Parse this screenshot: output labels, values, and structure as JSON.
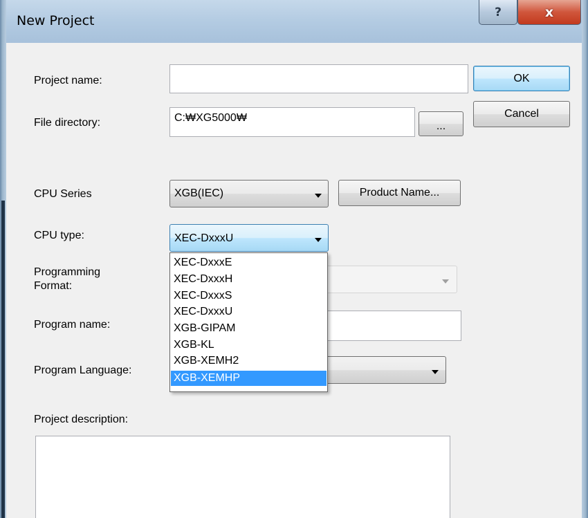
{
  "window": {
    "title": "New Project",
    "help_label": "?",
    "close_label": "x"
  },
  "form": {
    "project_name_label": "Project name:",
    "project_name_value": "",
    "file_directory_label": "File directory:",
    "file_directory_value": "C:₩XG5000₩",
    "browse_label": "...",
    "cpu_series_label": "CPU Series",
    "cpu_series_value": "XGB(IEC)",
    "product_name_label": "Product Name...",
    "cpu_type_label": "CPU type:",
    "cpu_type_value": "XEC-DxxxU",
    "programming_format_label_line1": "Programming",
    "programming_format_label_line2": "Format:",
    "programming_format_value": "",
    "program_name_label": "Program name:",
    "program_name_value": "",
    "program_language_label": "Program Language:",
    "program_language_value": "",
    "project_description_label": "Project description:",
    "project_description_value": ""
  },
  "buttons": {
    "ok_label": "OK",
    "cancel_label": "Cancel"
  },
  "cpu_type_dropdown": {
    "options": [
      "XEC-DxxxE",
      "XEC-DxxxH",
      "XEC-DxxxS",
      "XEC-DxxxU",
      "XGB-GIPAM",
      "XGB-KL",
      "XGB-XEMH2",
      "XGB-XEMHP"
    ],
    "highlighted": "XGB-XEMHP"
  },
  "colors": {
    "highlight": "#3399ff",
    "close_button": "#c23a1e",
    "titlebar": "#b3cbe2"
  }
}
